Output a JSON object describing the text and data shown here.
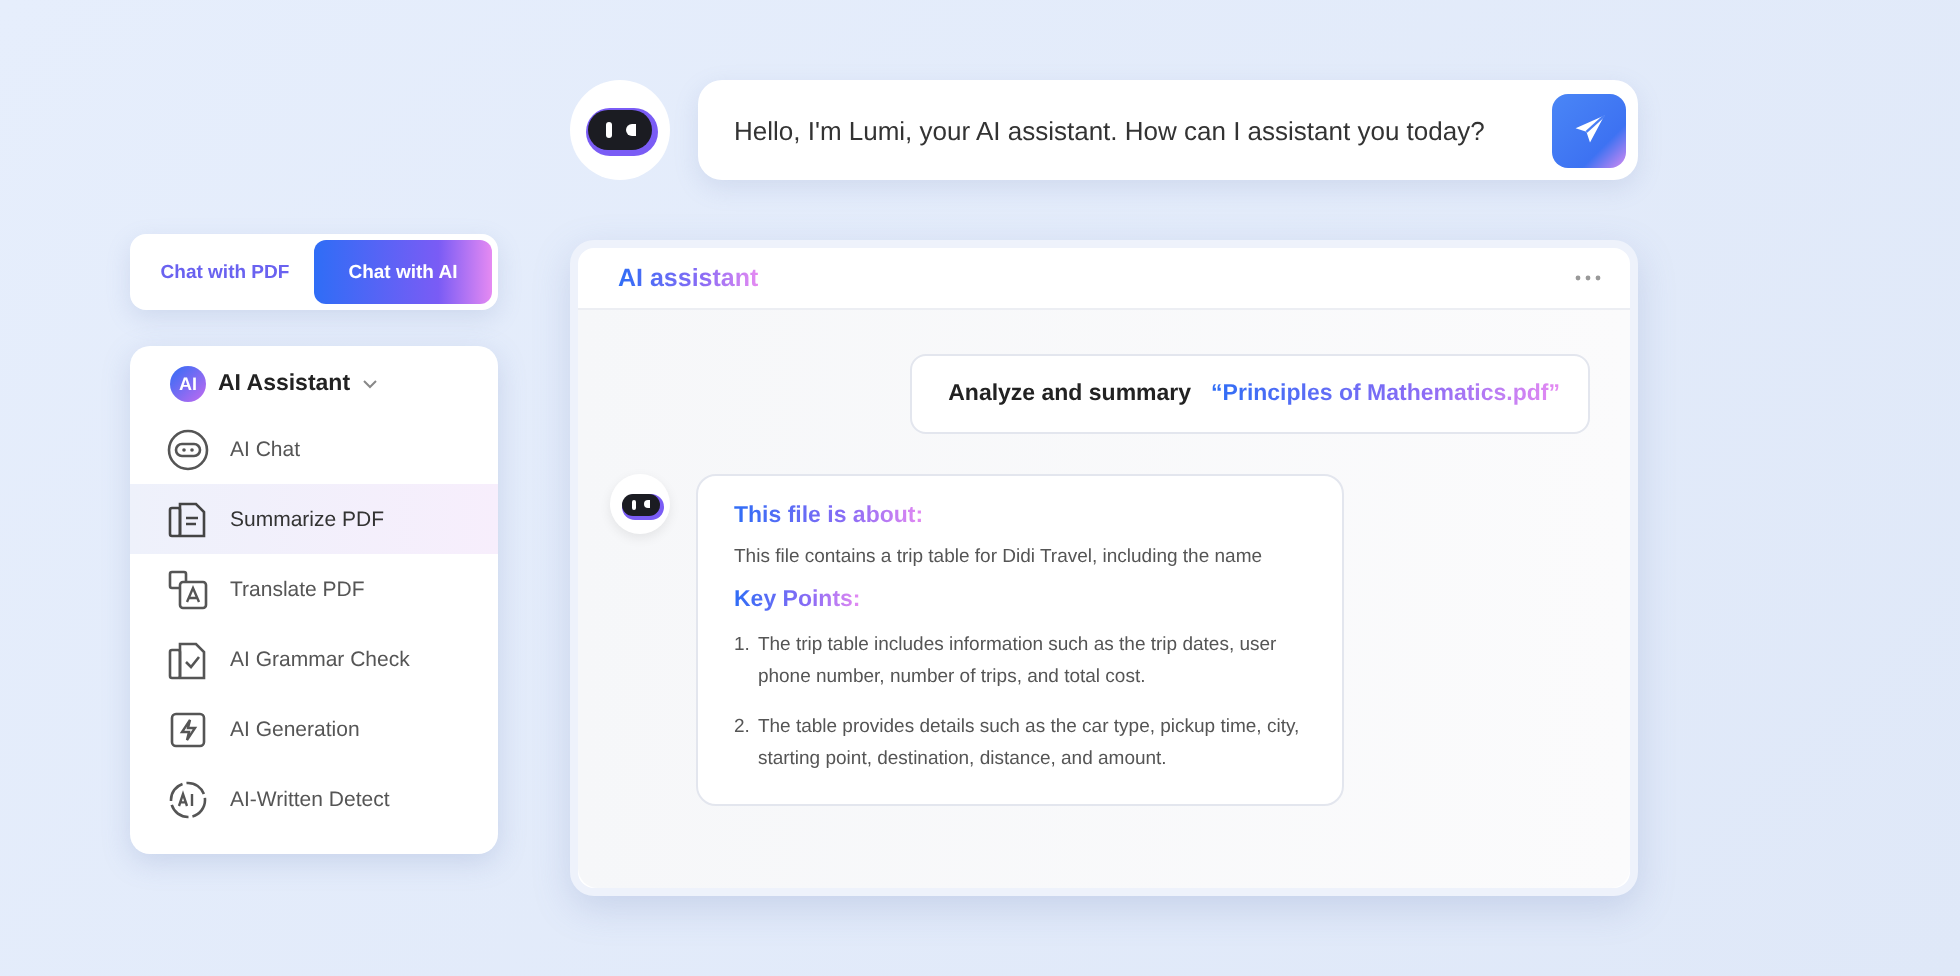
{
  "tabs": [
    {
      "label": "Chat with PDF",
      "selected": false
    },
    {
      "label": "Chat with AI",
      "selected": true
    }
  ],
  "menu": {
    "badge": "AI",
    "title": "AI Assistant",
    "items": [
      {
        "kind": "chat",
        "label": "AI Chat",
        "selected": false
      },
      {
        "kind": "summarize",
        "label": "Summarize PDF",
        "selected": true
      },
      {
        "kind": "translate",
        "label": "Translate PDF",
        "selected": false
      },
      {
        "kind": "grammar",
        "label": "AI Grammar Check",
        "selected": false
      },
      {
        "kind": "generation",
        "label": "AI Generation",
        "selected": false
      },
      {
        "kind": "detect",
        "label": "AI-Written Detect",
        "selected": false
      }
    ]
  },
  "prompt": {
    "text": "Hello, I'm Lumi, your AI assistant. How can I assistant you today?"
  },
  "panel": {
    "title": "AI assistant",
    "user_message": {
      "text": "Analyze and summary",
      "file": "“Principles of Mathematics.pdf”"
    },
    "reply": {
      "heading": "This file is about:",
      "summary": "This file contains a trip table for Didi Travel, including the name",
      "points_heading": "Key Points:",
      "points": [
        {
          "number": "1.",
          "text": "The trip table includes information such as the trip dates, user phone number, number of trips, and total cost."
        },
        {
          "number": "2.",
          "text": "The table provides details such as the car type, pickup time, city, starting point, destination, distance, and amount."
        }
      ]
    }
  }
}
